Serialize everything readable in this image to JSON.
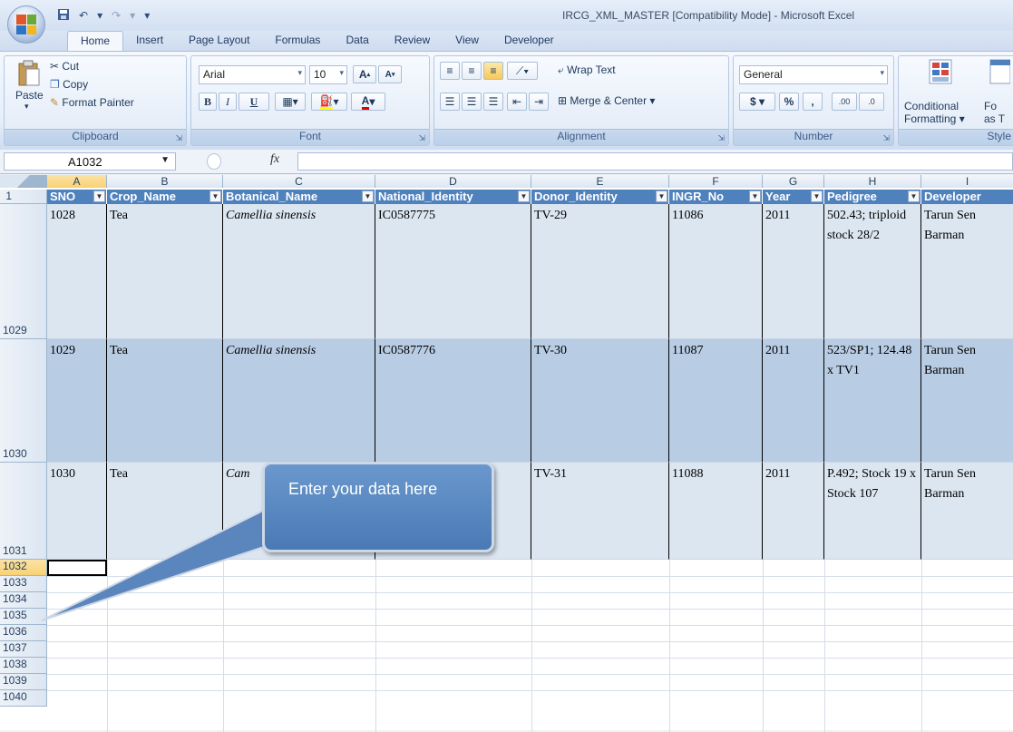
{
  "window": {
    "title": "IRCG_XML_MASTER  [Compatibility Mode] - Microsoft Excel"
  },
  "qat": {
    "save": "save-icon",
    "undo": "↶",
    "redo": "↷",
    "customize": "▾"
  },
  "tabs": [
    "Home",
    "Insert",
    "Page Layout",
    "Formulas",
    "Data",
    "Review",
    "View",
    "Developer"
  ],
  "ribbon": {
    "clipboard": {
      "label": "Clipboard",
      "paste": "Paste",
      "cut": "Cut",
      "copy": "Copy",
      "format_painter": "Format Painter"
    },
    "font": {
      "label": "Font",
      "font_name": "Arial",
      "font_size": "10",
      "bold": "B",
      "italic": "I",
      "underline": "U",
      "grow": "A",
      "shrink": "A",
      "color": "A"
    },
    "alignment": {
      "label": "Alignment",
      "wrap_text": "Wrap Text",
      "merge_center": "Merge & Center"
    },
    "number": {
      "label": "Number",
      "format": "General",
      "currency": "$",
      "percent": "%",
      "comma": ",",
      "inc_decimal": ".00",
      "dec_decimal": ".0"
    },
    "styles": {
      "label": "Style",
      "conditional_1": "Conditional",
      "conditional_2": "Formatting",
      "format_as_1": "Fo",
      "format_as_2": "as T"
    }
  },
  "formula_bar": {
    "name_box": "A1032",
    "fx": "fx",
    "value": ""
  },
  "columns": [
    "A",
    "B",
    "C",
    "D",
    "E",
    "F",
    "G",
    "H",
    "I"
  ],
  "header_row_number": "1",
  "headers": [
    "SNO",
    "Crop_Name",
    "Botanical_Name",
    "National_Identity",
    "Donor_Identity",
    "INGR_No",
    "Year",
    "Pedigree",
    "Developer"
  ],
  "rows": [
    {
      "num": "1029",
      "cells": [
        "1028",
        "Tea",
        "Camellia sinensis",
        "IC0587775",
        "TV-29",
        "11086",
        "2011",
        "502.43; triploid stock 28/2",
        "Tarun Sen Barman"
      ]
    },
    {
      "num": "1030",
      "cells": [
        "1029",
        "Tea",
        "Camellia sinensis",
        "IC0587776",
        "TV-30",
        "11087",
        "2011",
        "523/SP1; 124.48 x TV1",
        "Tarun Sen Barman"
      ]
    },
    {
      "num": "1031",
      "cells": [
        "1030",
        "Tea",
        "Cam",
        "",
        "TV-31",
        "11088",
        "2011",
        "P.492; Stock 19 x Stock 107",
        "Tarun Sen Barman"
      ]
    }
  ],
  "empty_rows": [
    "1032",
    "1033",
    "1034",
    "1035",
    "1036",
    "1037",
    "1038",
    "1039",
    "1040"
  ],
  "callout": {
    "text": "Enter your data here"
  },
  "colors": {
    "header_fill": "#4f81bd",
    "band_light": "#dce6f1",
    "band_dark": "#b8cce4",
    "callout": "#4f81bd"
  }
}
